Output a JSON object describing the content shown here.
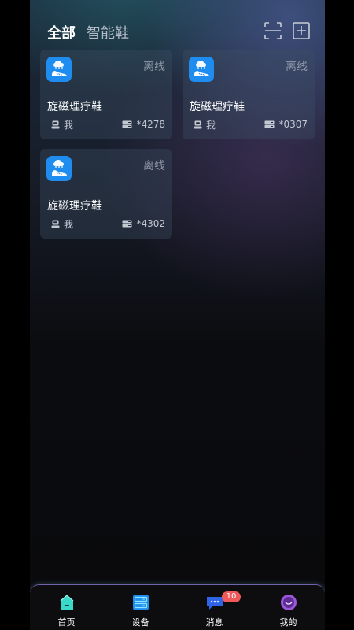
{
  "header": {
    "tabs": [
      {
        "label": "全部",
        "active": true
      },
      {
        "label": "智能鞋",
        "active": false
      }
    ],
    "icons": {
      "scan": "scan-frame-icon",
      "add": "add-square-icon"
    }
  },
  "devices": [
    {
      "name": "旋磁理疗鞋",
      "status": "离线",
      "owner": "我",
      "serial": "*4278"
    },
    {
      "name": "旋磁理疗鞋",
      "status": "离线",
      "owner": "我",
      "serial": "*0307"
    },
    {
      "name": "旋磁理疗鞋",
      "status": "离线",
      "owner": "我",
      "serial": "*4302"
    }
  ],
  "bottom_nav": {
    "items": [
      {
        "label": "首页",
        "icon": "home-icon"
      },
      {
        "label": "设备",
        "icon": "device-icon"
      },
      {
        "label": "消息",
        "icon": "message-icon",
        "badge": "10"
      },
      {
        "label": "我的",
        "icon": "profile-icon"
      }
    ]
  },
  "colors": {
    "accent_blue": "#1f8df0",
    "badge_red": "#f0595a",
    "status_gray": "#8e97a6"
  }
}
